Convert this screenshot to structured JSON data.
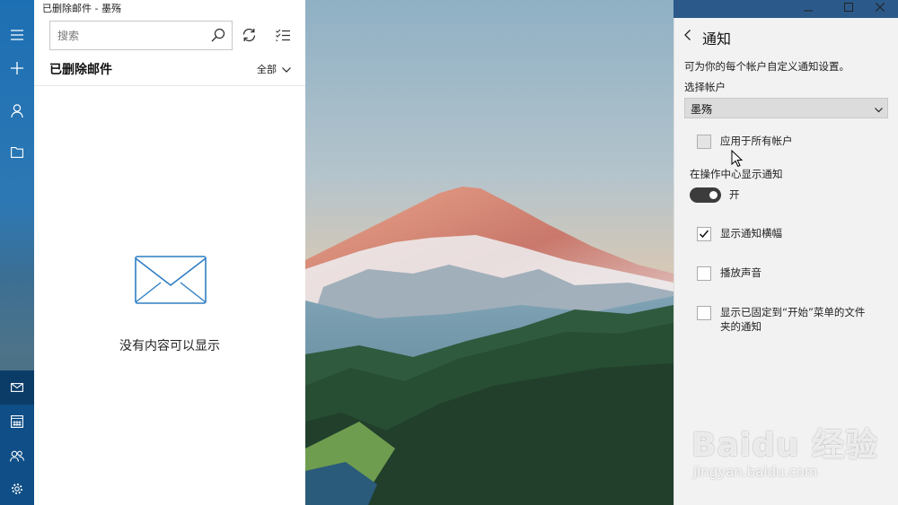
{
  "window": {
    "title": "已删除邮件 - 墨殇",
    "minimize_label": "—",
    "maximize_label": "□",
    "close_label": "✕"
  },
  "nav_rail": {
    "items": [
      "hamburger-menu-icon",
      "new-mail-icon",
      "accounts-icon",
      "folders-icon",
      "mail-icon",
      "calendar-icon",
      "people-icon",
      "settings-icon"
    ],
    "active": "mail-icon"
  },
  "mail_list": {
    "search_placeholder": "搜索",
    "folder_title": "已删除邮件",
    "filter_label": "全部",
    "empty_message": "没有内容可以显示"
  },
  "settings_panel": {
    "title": "通知",
    "description": "可为你的每个帐户自定义通知设置。",
    "select_account_label": "选择帐户",
    "selected_account": "墨殇",
    "apply_all_label": "应用于所有帐户",
    "apply_all_checked": false,
    "action_center_label": "在操作中心显示通知",
    "action_center_state": "开",
    "action_center_on": true,
    "banner_label": "显示通知横幅",
    "banner_checked": true,
    "sound_label": "播放声音",
    "sound_checked": false,
    "pinned_label_line1": "显示已固定到“开始”菜单的文件",
    "pinned_label_line2": "夹的通知",
    "pinned_checked": false
  },
  "watermark": {
    "logo": "Baidu 经验",
    "url": "jingyan.baidu.com"
  },
  "colors": {
    "accent": "#1d6fb3",
    "panel_bg": "#f2f2f2",
    "toggle_on": "#3c3c3c"
  }
}
